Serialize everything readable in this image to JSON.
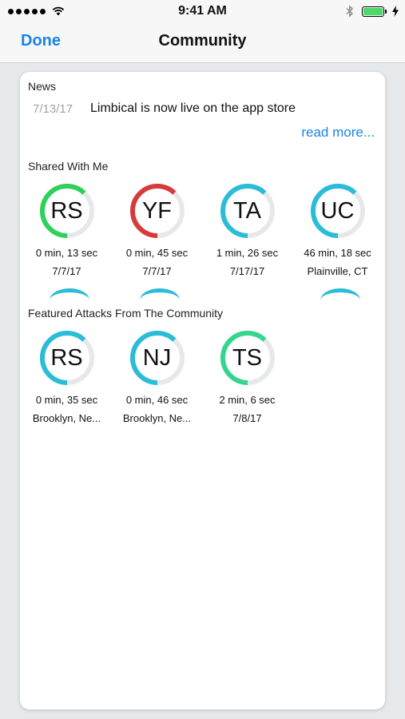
{
  "status_bar": {
    "time": "9:41 AM"
  },
  "nav": {
    "done_label": "Done",
    "title": "Community"
  },
  "news": {
    "section_title": "News",
    "date": "7/13/17",
    "headline": "Limbical is now live on the app store",
    "read_more": "read more..."
  },
  "shared": {
    "section_title": "Shared With Me",
    "items": [
      {
        "initials": "RS",
        "duration": "0 min, 13 sec",
        "detail": "7/7/17",
        "ring_color": "#2ed15a",
        "progress": 0.62
      },
      {
        "initials": "YF",
        "duration": "0 min, 45 sec",
        "detail": "7/7/17",
        "ring_color": "#d63a3a",
        "progress": 0.62
      },
      {
        "initials": "TA",
        "duration": "1 min, 26 sec",
        "detail": "7/17/17",
        "ring_color": "#2bbcd8",
        "progress": 0.62
      },
      {
        "initials": "UC",
        "duration": "46 min, 18 sec",
        "detail": "Plainville, CT",
        "ring_color": "#2bbcd8",
        "progress": 0.62
      }
    ]
  },
  "featured": {
    "section_title": "Featured Attacks From The Community",
    "items": [
      {
        "initials": "RS",
        "duration": "0 min, 35 sec",
        "detail": "Brooklyn, Ne...",
        "ring_color": "#2bbcd8",
        "progress": 0.62
      },
      {
        "initials": "NJ",
        "duration": "0 min, 46 sec",
        "detail": "Brooklyn, Ne...",
        "ring_color": "#2bbcd8",
        "progress": 0.62
      },
      {
        "initials": "TS",
        "duration": "2 min, 6 sec",
        "detail": "7/8/17",
        "ring_color": "#34d58f",
        "progress": 0.62
      }
    ]
  },
  "colors": {
    "accent": "#1a84e6",
    "ring_track": "#e6e8ea",
    "battery": "#4cd964"
  }
}
